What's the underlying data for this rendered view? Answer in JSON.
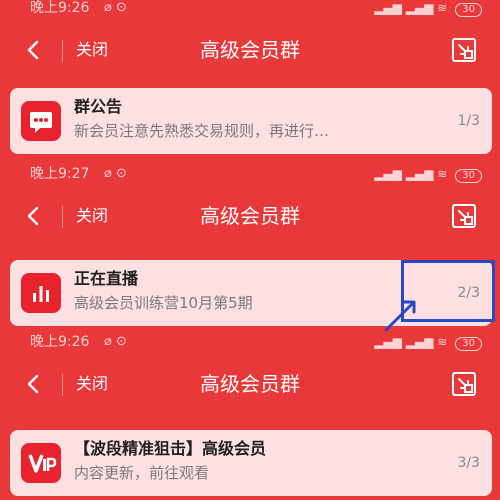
{
  "panels": [
    {
      "status": {
        "time": "晚上9:26",
        "battery": "30"
      },
      "nav": {
        "close_label": "关闭",
        "title": "高级会员群"
      },
      "announcement": {
        "title": "群公告",
        "text": "新会员注意先熟悉交易规则，再进行…",
        "page": "1/3",
        "icon": "message-dots-icon"
      }
    },
    {
      "status": {
        "time": "晚上9:27",
        "battery": "30"
      },
      "nav": {
        "close_label": "关闭",
        "title": "高级会员群"
      },
      "announcement": {
        "title": "正在直播",
        "text": "高级会员训练营10月第5期",
        "page": "2/3",
        "icon": "bar-chart-icon"
      }
    },
    {
      "status": {
        "time": "晚上9:26",
        "battery": "30"
      },
      "nav": {
        "close_label": "关闭",
        "title": "高级会员群"
      },
      "announcement": {
        "title": "【波段精准狙击】高级会员",
        "text": "内容更新，前往观看",
        "page": "3/3",
        "icon": "vip-icon"
      }
    }
  ],
  "colors": {
    "header_red": "#e8383a",
    "card_bg": "#fde0e1",
    "icon_red": "#e8232d",
    "highlight_blue": "#2a47c8"
  }
}
